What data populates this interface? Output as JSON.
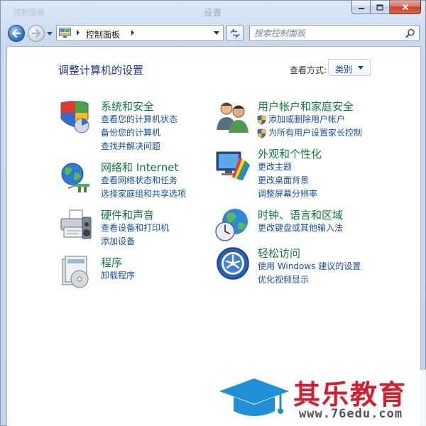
{
  "window": {
    "title": "设置",
    "ghost_title": "控制面板",
    "buttons": [
      "minimize",
      "maximize",
      "close"
    ]
  },
  "address": {
    "path": "控制面板",
    "search_placeholder": "搜索控制面板"
  },
  "main": {
    "heading": "调整计算机的设置",
    "view_by_label": "查看方式:",
    "view_by_value": "类别"
  },
  "categories": {
    "system": {
      "title": "系统和安全",
      "icon": "system-security-icon",
      "links": [
        "查看您的计算机状态",
        "备份您的计算机",
        "查找并解决问题"
      ]
    },
    "network": {
      "title": "网络和 Internet",
      "icon": "network-icon",
      "links": [
        "查看网络状态和任务",
        "选择家庭组和共享选项"
      ]
    },
    "hardware": {
      "title": "硬件和声音",
      "icon": "printer-icon",
      "links": [
        "查看设备和打印机",
        "添加设备"
      ]
    },
    "programs": {
      "title": "程序",
      "icon": "programs-icon",
      "links": [
        "卸载程序"
      ]
    },
    "accounts": {
      "title": "用户帐户和家庭安全",
      "icon": "users-icon",
      "links": [
        "添加或删除用户帐户",
        "为所有用户设置家长控制"
      ]
    },
    "appearance": {
      "title": "外观和个性化",
      "icon": "appearance-icon",
      "links": [
        "更改主题",
        "更改桌面背景",
        "调整屏幕分辨率"
      ]
    },
    "clock": {
      "title": "时钟、语言和区域",
      "icon": "clock-globe-icon",
      "links": [
        "更改键盘或其他输入法"
      ]
    },
    "ease": {
      "title": "轻松访问",
      "icon": "ease-of-access-icon",
      "links": [
        "使用 Windows 建议的设置",
        "优化视频显示"
      ]
    }
  },
  "watermark": {
    "brand": "其乐教育",
    "url": "www.76edu.com"
  },
  "colors": {
    "heading_blue": "#1e3287",
    "category_green": "#0f7a3a",
    "link_blue": "#1550a3",
    "brand_red": "#d61d2c"
  }
}
